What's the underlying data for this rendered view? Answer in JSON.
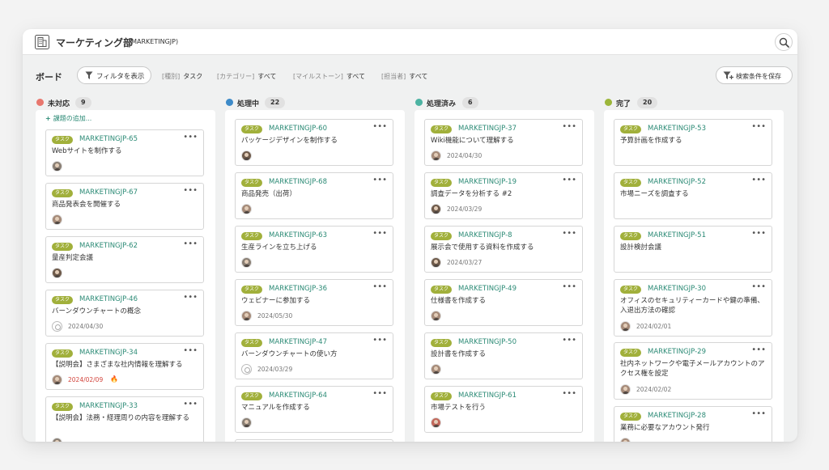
{
  "project": {
    "name": "マーケティング部",
    "key": "(MARKETINGJP)"
  },
  "toolbar": {
    "board_title": "ボード",
    "filter_button": "フィルタを表示",
    "filters": [
      {
        "key": "[種別]",
        "value": "タスク"
      },
      {
        "key": "[カテゴリー]",
        "value": "すべて"
      },
      {
        "key": "[マイルストーン]",
        "value": "すべて"
      },
      {
        "key": "[担当者]",
        "value": "すべて"
      }
    ],
    "save_button": "検索条件を保存"
  },
  "add_task_label": "課題の追加...",
  "colors": {
    "accent": "#2b8a75",
    "tag": "#a1b03b",
    "overdue": "#d2453d"
  },
  "columns": [
    {
      "name": "未対応",
      "count": "9",
      "color": "#e8776e",
      "cards": [
        {
          "tag": "タスク",
          "key": "MARKETINGJP-65",
          "title": "Webサイトを制作する",
          "date": ""
        },
        {
          "tag": "タスク",
          "key": "MARKETINGJP-67",
          "title": "商品発表会を開催する",
          "date": ""
        },
        {
          "tag": "タスク",
          "key": "MARKETINGJP-62",
          "title": "量産判定会議",
          "date": ""
        },
        {
          "tag": "タスク",
          "key": "MARKETINGJP-46",
          "title": "バーンダウンチャートの概念",
          "date": "2024/04/30"
        },
        {
          "tag": "タスク",
          "key": "MARKETINGJP-34",
          "title": "【説明会】さまざまな社内情報を理解する",
          "date": "2024/02/09"
        },
        {
          "tag": "タスク",
          "key": "MARKETINGJP-33",
          "title": "【説明会】法務・経理周りの内容を理解する",
          "date": ""
        }
      ]
    },
    {
      "name": "処理中",
      "count": "22",
      "color": "#3d8ac8",
      "cards": [
        {
          "tag": "タスク",
          "key": "MARKETINGJP-60",
          "title": "パッケージデザインを制作する",
          "date": ""
        },
        {
          "tag": "タスク",
          "key": "MARKETINGJP-68",
          "title": "商品発売（出荷）",
          "date": ""
        },
        {
          "tag": "タスク",
          "key": "MARKETINGJP-63",
          "title": "生産ラインを立ち上げる",
          "date": ""
        },
        {
          "tag": "タスク",
          "key": "MARKETINGJP-36",
          "title": "ウェビナーに参加する",
          "date": "2024/05/30"
        },
        {
          "tag": "タスク",
          "key": "MARKETINGJP-47",
          "title": "バーンダウンチャートの使い方",
          "date": "2024/03/29"
        },
        {
          "tag": "タスク",
          "key": "MARKETINGJP-64",
          "title": "マニュアルを作成する",
          "date": ""
        }
      ]
    },
    {
      "name": "処理済み",
      "count": "6",
      "color": "#4cb3a2",
      "cards": [
        {
          "tag": "タスク",
          "key": "MARKETINGJP-37",
          "title": "Wiki機能について理解する",
          "date": "2024/04/30"
        },
        {
          "tag": "タスク",
          "key": "MARKETINGJP-19",
          "title": "調査データを分析する #2",
          "date": "2024/03/29"
        },
        {
          "tag": "タスク",
          "key": "MARKETINGJP-8",
          "title": "展示会で使用する資料を作成する",
          "date": "2024/03/27"
        },
        {
          "tag": "タスク",
          "key": "MARKETINGJP-49",
          "title": "仕様書を作成する",
          "date": ""
        },
        {
          "tag": "タスク",
          "key": "MARKETINGJP-50",
          "title": "設計書を作成する",
          "date": ""
        },
        {
          "tag": "タスク",
          "key": "MARKETINGJP-61",
          "title": "市場テストを行う",
          "date": ""
        }
      ]
    },
    {
      "name": "完了",
      "count": "20",
      "color": "#9cb63a",
      "cards": [
        {
          "tag": "タスク",
          "key": "MARKETINGJP-53",
          "title": "予算計画を作成する",
          "date": ""
        },
        {
          "tag": "タスク",
          "key": "MARKETINGJP-52",
          "title": "市場ニーズを調査する",
          "date": ""
        },
        {
          "tag": "タスク",
          "key": "MARKETINGJP-51",
          "title": "設計検討会議",
          "date": ""
        },
        {
          "tag": "タスク",
          "key": "MARKETINGJP-30",
          "title": "オフィスのセキュリティーカードや鍵の準備、入退出方法の確認",
          "date": "2024/02/01"
        },
        {
          "tag": "タスク",
          "key": "MARKETINGJP-29",
          "title": "社内ネットワークや電子メールアカウントのアクセス権を設定",
          "date": "2024/02/02"
        },
        {
          "tag": "タスク",
          "key": "MARKETINGJP-28",
          "title": "業務に必要なアカウント発行",
          "date": ""
        }
      ]
    }
  ]
}
